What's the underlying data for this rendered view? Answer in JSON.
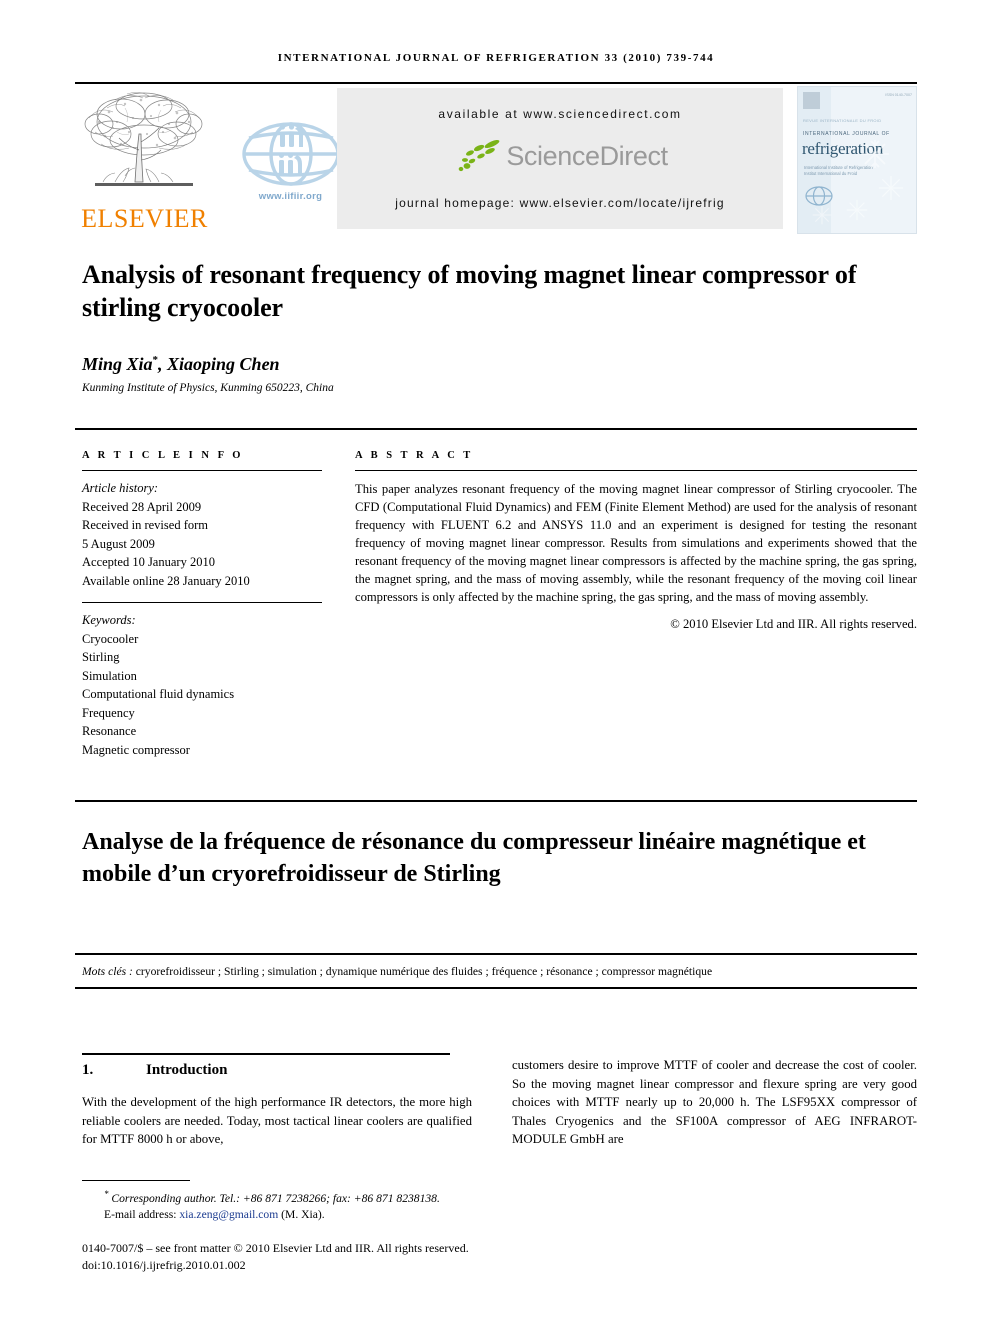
{
  "running_head": "INTERNATIONAL JOURNAL OF REFRIGERATION 33 (2010) 739-744",
  "masthead": {
    "elsevier_wordmark": "ELSEVIER",
    "iir_url": "www.iifiir.org",
    "sciencedirect": {
      "available_at": "available at www.sciencedirect.com",
      "logo_text": "ScienceDirect",
      "journal_homepage": "journal homepage: www.elsevier.com/locate/ijrefrig"
    },
    "cover": {
      "line_top": "REVUE INTERNATIONALE DU FROID",
      "line_small": "INTERNATIONAL JOURNAL OF",
      "title": "refrigeration",
      "subtitle": "International Institute of Refrigeration\nInstitut International du Froid",
      "issn": "ISSN 0140-7007"
    }
  },
  "article": {
    "title": "Analysis of resonant frequency of moving magnet linear compressor of stirling cryocooler",
    "authors": "Ming Xia, Xiaoping Chen",
    "author_star": "*",
    "affiliation": "Kunming Institute of Physics, Kunming 650223, China"
  },
  "info": {
    "heading": "A R T I C L E   I N F O",
    "history_label": "Article history:",
    "history": [
      "Received 28 April 2009",
      "Received in revised form",
      "5 August 2009",
      "Accepted 10 January 2010",
      "Available online 28 January 2010"
    ],
    "keywords_label": "Keywords:",
    "keywords": [
      "Cryocooler",
      "Stirling",
      "Simulation",
      "Computational fluid dynamics",
      "Frequency",
      "Resonance",
      "Magnetic compressor"
    ]
  },
  "abstract": {
    "heading": "A B S T R A C T",
    "text": "This paper analyzes resonant frequency of the moving magnet linear compressor of Stirling cryocooler. The CFD (Computational Fluid Dynamics) and FEM (Finite Element Method) are used for the analysis of resonant frequency with FLUENT 6.2 and ANSYS 11.0 and an experiment is designed for testing the resonant frequency of moving magnet linear compressor. Results from simulations and experiments showed that the resonant frequency of the moving magnet linear compressors is affected by the machine spring, the gas spring, the magnet spring, and the mass of moving assembly, while the resonant frequency of the moving coil linear compressors is only affected by the machine spring, the gas spring, and the mass of moving assembly.",
    "copyright": "© 2010 Elsevier Ltd and IIR. All rights reserved."
  },
  "french": {
    "title": "Analyse de la fréquence de résonance du compresseur linéaire magnétique et mobile d’un cryorefroidisseur de Stirling",
    "keywords_label": "Mots clés :",
    "keywords": "cryorefroidisseur ; Stirling ; simulation ; dynamique numérique des fluides ; fréquence ; résonance ; compressor magnétique"
  },
  "body": {
    "section_number": "1.",
    "section_title": "Introduction",
    "left_paragraph": "With the development of the high performance IR detectors, the more high reliable coolers are needed. Today, most tactical linear coolers are qualified for MTTF 8000 h or above,",
    "right_paragraph": "customers desire to improve MTTF of cooler and decrease the cost of cooler. So the moving magnet linear compressor and flexure spring are very good choices with MTTF nearly up to 20,000 h. The LSF95XX compressor of Thales Cryogenics and the SF100A compressor of AEG INFRAROT-MODULE GmbH are"
  },
  "footnotes": {
    "corresponding_star": "*",
    "corresponding": "Corresponding author. Tel.: +86 871 7238266; fax: +86 871 8238138.",
    "email_label": "E-mail address:",
    "email": "xia.zeng@gmail.com",
    "email_suffix": "(M. Xia).",
    "front_matter": "0140-7007/$ – see front matter © 2010 Elsevier Ltd and IIR. All rights reserved.",
    "doi": "doi:10.1016/j.ijrefrig.2010.01.002"
  },
  "colors": {
    "elsevier_orange": "#F08000",
    "iir_blue": "#b9d4e8",
    "sciencedirect_green": "#7ab317",
    "sciencedirect_gray": "#9a9a9a",
    "link_blue": "#1a3a8f",
    "banner_gray": "#ececec"
  }
}
